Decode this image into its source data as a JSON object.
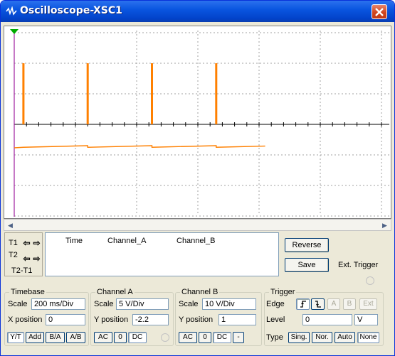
{
  "window": {
    "title": "Oscilloscope-XSC1"
  },
  "colors": {
    "trace": "#ff8000",
    "title_bar": "#0a56e0",
    "trigger_marker": "#00aa00"
  },
  "cursor_panel": {
    "t1": "T1",
    "t2": "T2",
    "t2_t1": "T2-T1"
  },
  "readout": {
    "time_header": "Time",
    "channel_a_header": "Channel_A",
    "channel_b_header": "Channel_B"
  },
  "buttons": {
    "reverse": "Reverse",
    "save": "Save"
  },
  "ext_trigger": "Ext. Trigger",
  "timebase": {
    "title": "Timebase",
    "scale_label": "Scale",
    "scale_value": "200 ms/Div",
    "xpos_label": "X position",
    "xpos_value": "0",
    "modes": [
      "Y/T",
      "Add",
      "B/A",
      "A/B"
    ]
  },
  "channel_a": {
    "title": "Channel A",
    "scale_label": "Scale",
    "scale_value": "5  V/Div",
    "ypos_label": "Y position",
    "ypos_value": "-2.2",
    "coupling": [
      "AC",
      "0",
      "DC"
    ]
  },
  "channel_b": {
    "title": "Channel B",
    "scale_label": "Scale",
    "scale_value": "10  V/Div",
    "ypos_label": "Y position",
    "ypos_value": "1",
    "coupling": [
      "AC",
      "0",
      "DC",
      "-"
    ]
  },
  "trigger": {
    "title": "Trigger",
    "edge_label": "Edge",
    "level_label": "Level",
    "level_value": "0",
    "level_unit": "V",
    "edge_buttons": [
      "A",
      "B",
      "Ext"
    ],
    "type_label": "Type",
    "types": [
      "Sing.",
      "Nor.",
      "Auto",
      "None"
    ]
  },
  "chart_data": {
    "type": "line",
    "x_unit": "div",
    "grid": true,
    "series": [
      {
        "channel": "B",
        "kind": "pulses",
        "pulse_x": [
          0.15,
          1.2,
          2.25,
          3.3
        ],
        "pulse_top_div": 2.0
      },
      {
        "channel": "A",
        "kind": "sawtooth",
        "period_div": 1.05,
        "x_end": 4.1,
        "low_div": -0.75,
        "high_div": 0.0
      }
    ]
  }
}
